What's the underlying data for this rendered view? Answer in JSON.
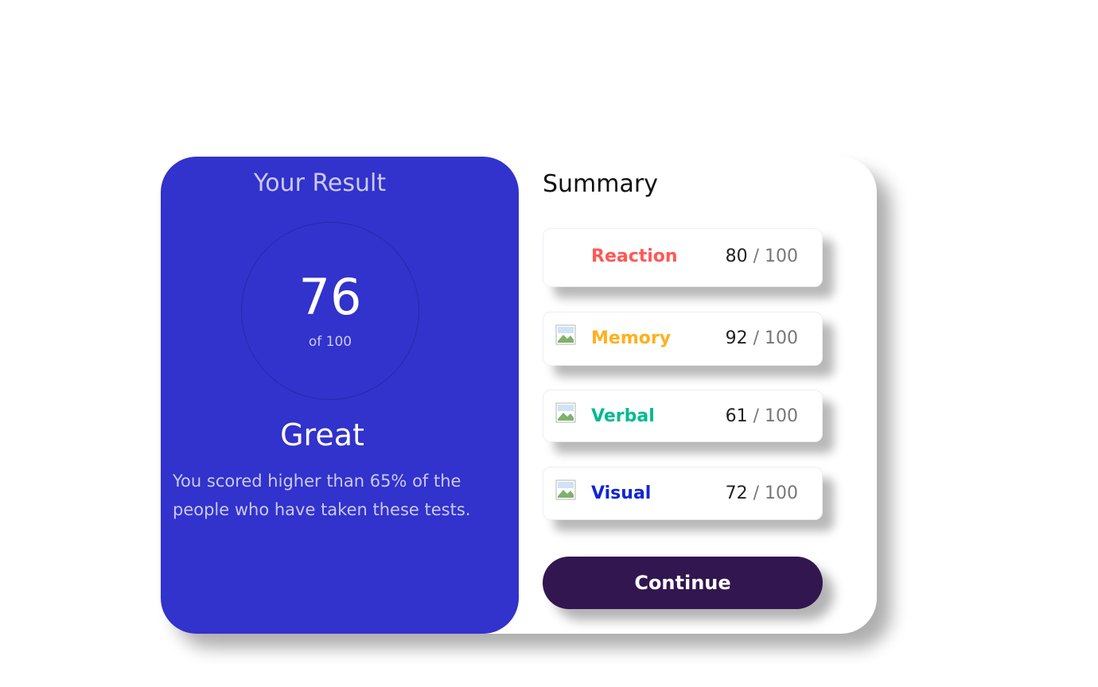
{
  "result": {
    "title": "Your Result",
    "score": "76",
    "score_of": "of 100",
    "rating": "Great",
    "description": "You scored higher than 65% of the people who have taken these tests."
  },
  "summary": {
    "title": "Summary",
    "items": [
      {
        "label": "Reaction",
        "score": "80",
        "total": "/ 100",
        "color": "#ff5757",
        "icon": "broken-image-icon"
      },
      {
        "label": "Memory",
        "score": "92",
        "total": "/ 100",
        "color": "#ffb01f",
        "icon": "broken-image-icon"
      },
      {
        "label": "Verbal",
        "score": "61",
        "total": "/ 100",
        "color": "#00bb8f",
        "icon": "broken-image-icon"
      },
      {
        "label": "Visual",
        "score": "72",
        "total": "/ 100",
        "color": "#1125d6",
        "icon": "broken-image-icon"
      }
    ]
  },
  "continue_label": "Continue",
  "colors": {
    "result_bg": "#3232cc",
    "button_bg": "#321650"
  }
}
